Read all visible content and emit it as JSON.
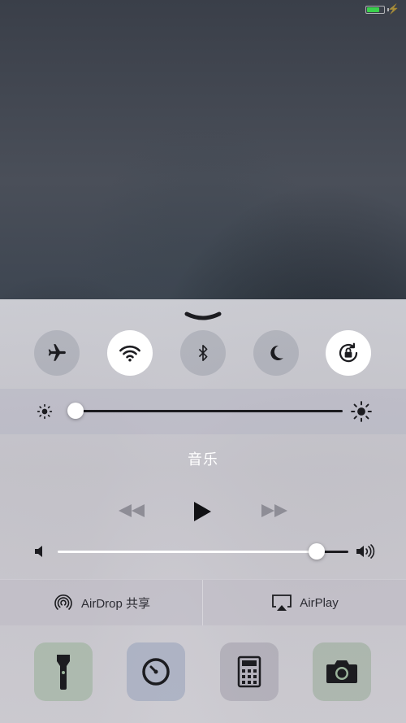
{
  "status_bar": {
    "battery_level": 0.75,
    "charging": true
  },
  "toggles": [
    {
      "name": "airplane-mode",
      "icon": "airplane-icon",
      "active": false
    },
    {
      "name": "wifi",
      "icon": "wifi-icon",
      "active": true
    },
    {
      "name": "bluetooth",
      "icon": "bluetooth-icon",
      "active": false
    },
    {
      "name": "do-not-disturb",
      "icon": "moon-icon",
      "active": false
    },
    {
      "name": "rotation-lock",
      "icon": "rotation-lock-icon",
      "active": true
    }
  ],
  "brightness": {
    "level": 0.02
  },
  "music": {
    "title": "音乐",
    "volume": 0.89
  },
  "share": {
    "airdrop_label": "AirDrop 共享",
    "airplay_label": "AirPlay"
  },
  "quick_actions": [
    {
      "name": "flashlight",
      "icon": "flashlight-icon"
    },
    {
      "name": "timer",
      "icon": "timer-icon"
    },
    {
      "name": "calculator",
      "icon": "calculator-icon"
    },
    {
      "name": "camera",
      "icon": "camera-icon"
    }
  ],
  "colors": {
    "accent_on": "#ffffff",
    "track_dark": "#1c1c20",
    "battery_green": "#3ad14c"
  }
}
